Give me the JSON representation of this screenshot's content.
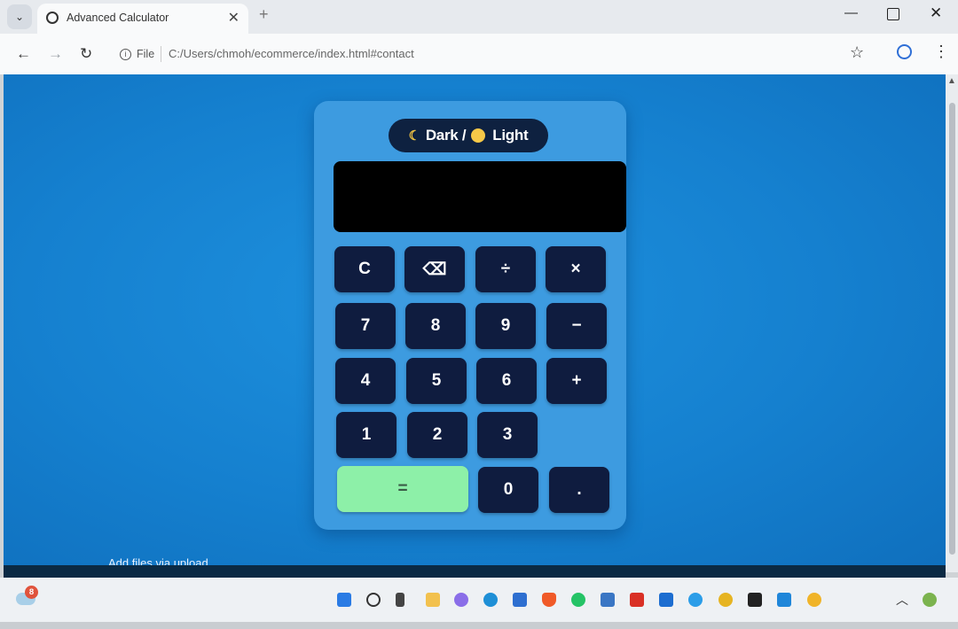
{
  "browser": {
    "tab_title": "Advanced Calculator",
    "tab_close": "✕",
    "new_tab": "+",
    "address_prefix": "File",
    "url": "C:/Users/chmoh/ecommerce/index.html#contact"
  },
  "calculator": {
    "theme_toggle": {
      "dark_label": "Dark /",
      "light_label": "Light"
    },
    "display_value": "",
    "keys": {
      "clear": "C",
      "backspace": "⌫",
      "divide": "÷",
      "multiply": "×",
      "seven": "7",
      "eight": "8",
      "nine": "9",
      "subtract": "−",
      "four": "4",
      "five": "5",
      "six": "6",
      "add": "+",
      "one": "1",
      "two": "2",
      "three": "3",
      "equals": "=",
      "zero": "0",
      "decimal": "."
    }
  },
  "page": {
    "partial_text": "Add files via upload"
  },
  "taskbar": {
    "notification_count": "8"
  },
  "colors": {
    "page_background": "#1580cf",
    "calculator_body": "#3d9be0",
    "key_background": "#0f1c3f",
    "equals_key": "#8df0a8",
    "display": "#000000"
  }
}
